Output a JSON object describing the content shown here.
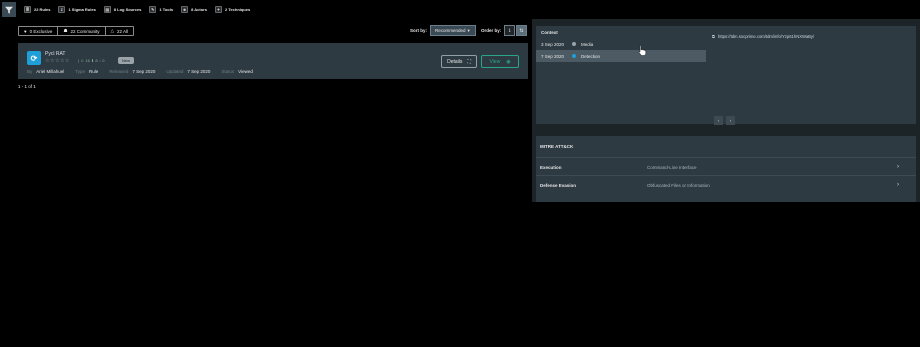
{
  "topbar": {
    "stats": [
      {
        "icon": "list-icon",
        "glyph": "≣",
        "label": "22 Rules"
      },
      {
        "icon": "sigma-icon",
        "glyph": "Σ",
        "label": "1 Sigma Rules"
      },
      {
        "icon": "log-icon",
        "glyph": "▤",
        "label": "8 Log Sources"
      },
      {
        "icon": "wrench-icon",
        "glyph": "✎",
        "label": "1 Tools"
      },
      {
        "icon": "actor-icon",
        "glyph": "☻",
        "label": "8 Actors"
      },
      {
        "icon": "technique-icon",
        "glyph": "✦",
        "label": "2 Techniques"
      }
    ]
  },
  "filters": {
    "exclusive": "0 Exclusive",
    "community": "22 Community",
    "all": "22 All"
  },
  "sort": {
    "label": "Sort by:",
    "value": "Recommended",
    "order_label": "Order by:"
  },
  "result": {
    "title": "Pycl RAT",
    "stars": "☆☆☆☆☆",
    "mini_stats": "| ☺ 16 ⬇ 8 ◌ 0",
    "badge": "New",
    "meta": {
      "by_key": "By",
      "by_val": "Ariel Millahuel",
      "type_key": "Type",
      "type_val": "Rule",
      "released_key": "Released",
      "released_val": "7 Sep 2020",
      "updated_key": "Updated",
      "updated_val": "7 Sep 2020",
      "status_key": "Status",
      "status_val": "Viewed"
    },
    "details_label": "Details",
    "view_label": "View"
  },
  "pagination": "1 - 1 of 1",
  "context": {
    "header": "Context",
    "rows": [
      {
        "date": "3 Sep 2020",
        "label": "Media",
        "color": "#9aa3a8"
      },
      {
        "date": "7 Sep 2020",
        "label": "Detection",
        "color": "#1e9fd8"
      }
    ],
    "link": "https://tdm.socprime.com/tdm/info/Yzp61hNXWaBy/"
  },
  "mitre": {
    "title": "MITRE ATT&CK",
    "rows": [
      {
        "tactic": "Execution",
        "technique": "Command-Line Interface"
      },
      {
        "tactic": "Defense Evasion",
        "technique": "Obfuscated Files or Information"
      }
    ]
  },
  "colors": {
    "accent": "#1e9fd8",
    "view": "#2aa58a",
    "panel": "#2d3a42"
  }
}
